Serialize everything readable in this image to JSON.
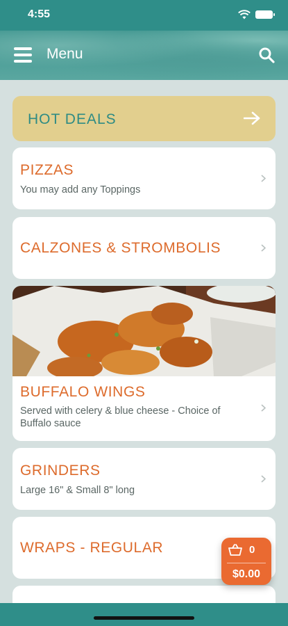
{
  "status_bar": {
    "time": "4:55"
  },
  "header": {
    "title": "Menu"
  },
  "hot_deals": {
    "label": "HOT DEALS"
  },
  "categories": [
    {
      "title": "PIZZAS",
      "subtitle": "You may add any Toppings"
    },
    {
      "title": "CALZONES & STROMBOLIS"
    },
    {
      "title": "BUFFALO WINGS",
      "subtitle_line1": "Served with celery & blue cheese - Choice of",
      "subtitle_line2": "Buffalo sauce"
    },
    {
      "title": "GRINDERS",
      "subtitle": "Large 16\" & Small 8\" long"
    },
    {
      "title": "WRAPS - REGULAR"
    }
  ],
  "cart": {
    "count": "0",
    "total": "$0.00"
  },
  "colors": {
    "brand_teal": "#2f8e89",
    "accent_orange": "#dd6b2c",
    "deals_bg": "#e2cf8e"
  }
}
